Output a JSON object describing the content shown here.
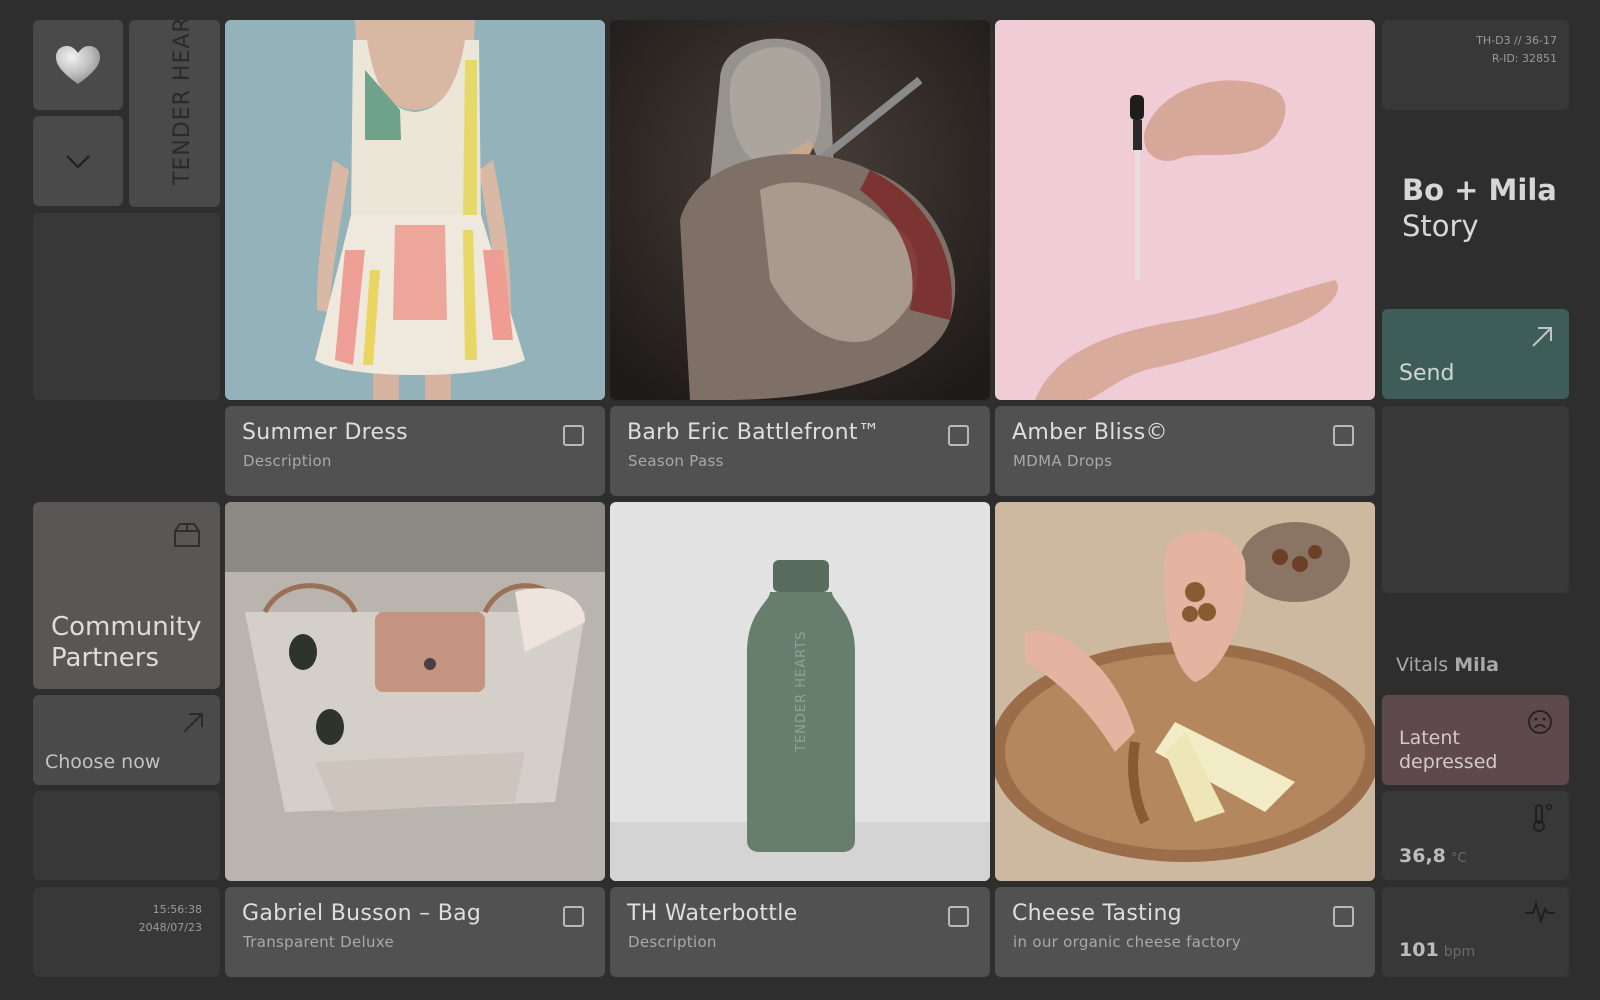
{
  "brand": {
    "logo_text": "TENDER HEARTS"
  },
  "top_right": {
    "code_line1": "TH-D3 // 36-17",
    "code_line2": "R-ID: 32851"
  },
  "story": {
    "title_line1": "Bo + Mila",
    "title_line2": "Story"
  },
  "send": {
    "label": "Send"
  },
  "community": {
    "line1": "Community",
    "line2": "Partners"
  },
  "choose": {
    "label": "Choose now"
  },
  "clock": {
    "time": "15:56:38",
    "date": "2048/07/23"
  },
  "vitals": {
    "heading": "Vitals",
    "name": "Mila",
    "mood_line1": "Latent",
    "mood_line2": "depressed",
    "temperature": "36,8",
    "temperature_unit": "°C",
    "pulse": "101",
    "pulse_unit": "bpm"
  },
  "products": [
    {
      "title": "Summer Dress",
      "subtitle": "Description"
    },
    {
      "title": "Barb Eric Battlefront™",
      "subtitle": "Season Pass"
    },
    {
      "title": "Amber Bliss©",
      "subtitle": "MDMA Drops"
    },
    {
      "title": "Gabriel Busson – Bag",
      "subtitle": "Transparent Deluxe"
    },
    {
      "title": "TH Waterbottle",
      "subtitle": "Description"
    },
    {
      "title": "Cheese Tasting",
      "subtitle": "in our organic cheese factory"
    }
  ],
  "bottle_logo_text": "TENDER HEARTS",
  "colors": {
    "background": "#2e2e2e",
    "tile": "#383838",
    "send_tile": "#3f5d58",
    "mood_tile": "#5e4a4d"
  },
  "icons": [
    "heart-icon",
    "chevron-down-icon",
    "box-icon",
    "arrow-up-right-icon",
    "sad-face-icon",
    "thermometer-icon",
    "heartbeat-icon"
  ]
}
